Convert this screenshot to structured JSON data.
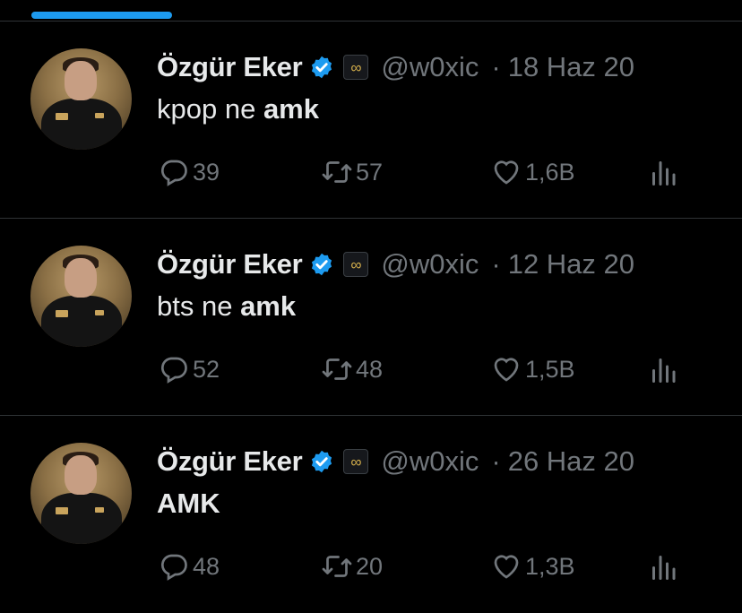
{
  "tweets": [
    {
      "display_name": "Özgür Eker",
      "handle": "@w0xic",
      "separator": "·",
      "date": "18 Haz 20",
      "text_plain": "kpop ne ",
      "text_bold": "amk",
      "replies": "39",
      "retweets": "57",
      "likes": "1,6B"
    },
    {
      "display_name": "Özgür Eker",
      "handle": "@w0xic",
      "separator": "·",
      "date": "12 Haz 20",
      "text_plain": "bts ne ",
      "text_bold": "amk",
      "replies": "52",
      "retweets": "48",
      "likes": "1,5B"
    },
    {
      "display_name": "Özgür Eker",
      "handle": "@w0xic",
      "separator": "·",
      "date": "26 Haz 20",
      "text_plain": "",
      "text_bold": "AMK",
      "replies": "48",
      "retweets": "20",
      "likes": "1,3B"
    }
  ],
  "colors": {
    "background": "#000000",
    "text": "#e7e9ea",
    "muted": "#71767b",
    "accent": "#1d9bf0",
    "divider": "#2f3336"
  },
  "icons": [
    "verified-badge-icon",
    "affiliate-badge-icon",
    "reply-icon",
    "retweet-icon",
    "like-icon",
    "views-icon"
  ]
}
